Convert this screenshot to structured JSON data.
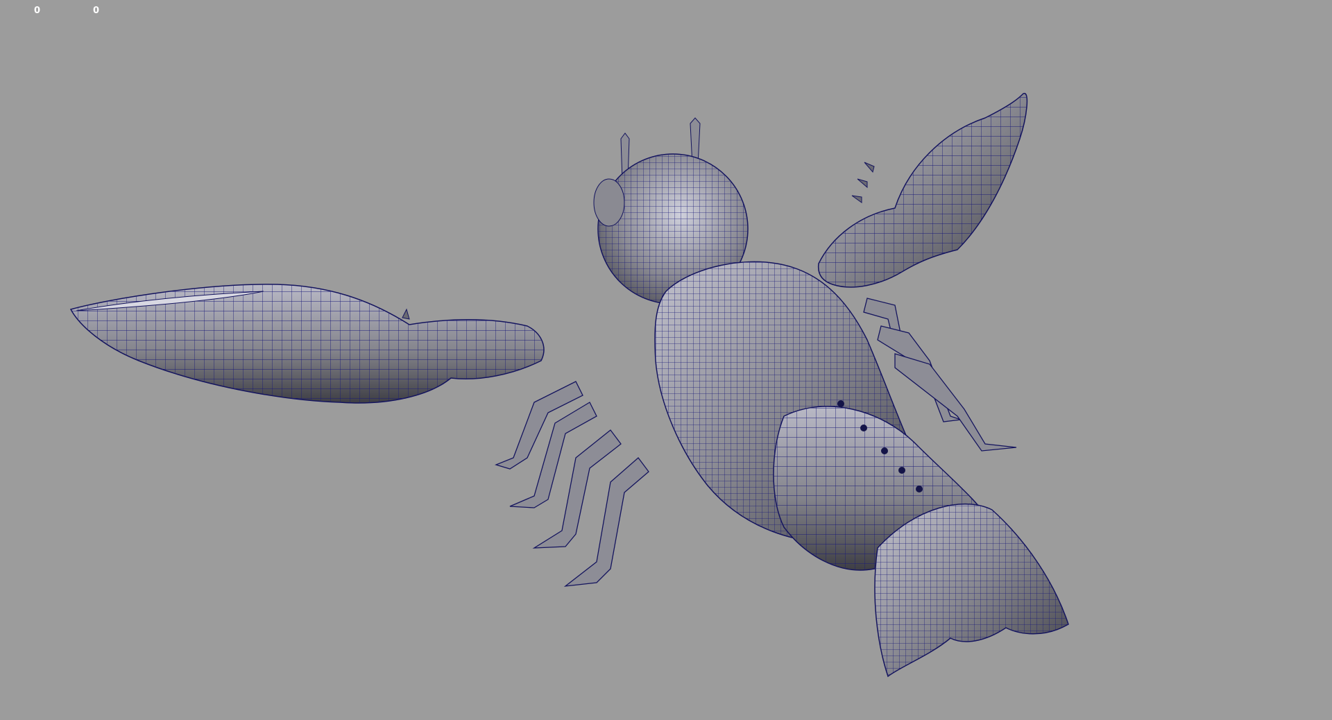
{
  "viewport": {
    "background": "#9c9c9c",
    "shading": "smooth-shaded-with-wireframe",
    "wire_color": "#16166e",
    "surface_color": "#7f7f85"
  },
  "hud": {
    "left_value": "0",
    "right_value": "0"
  },
  "model": {
    "subject": "crayfish-polygon-mesh"
  }
}
